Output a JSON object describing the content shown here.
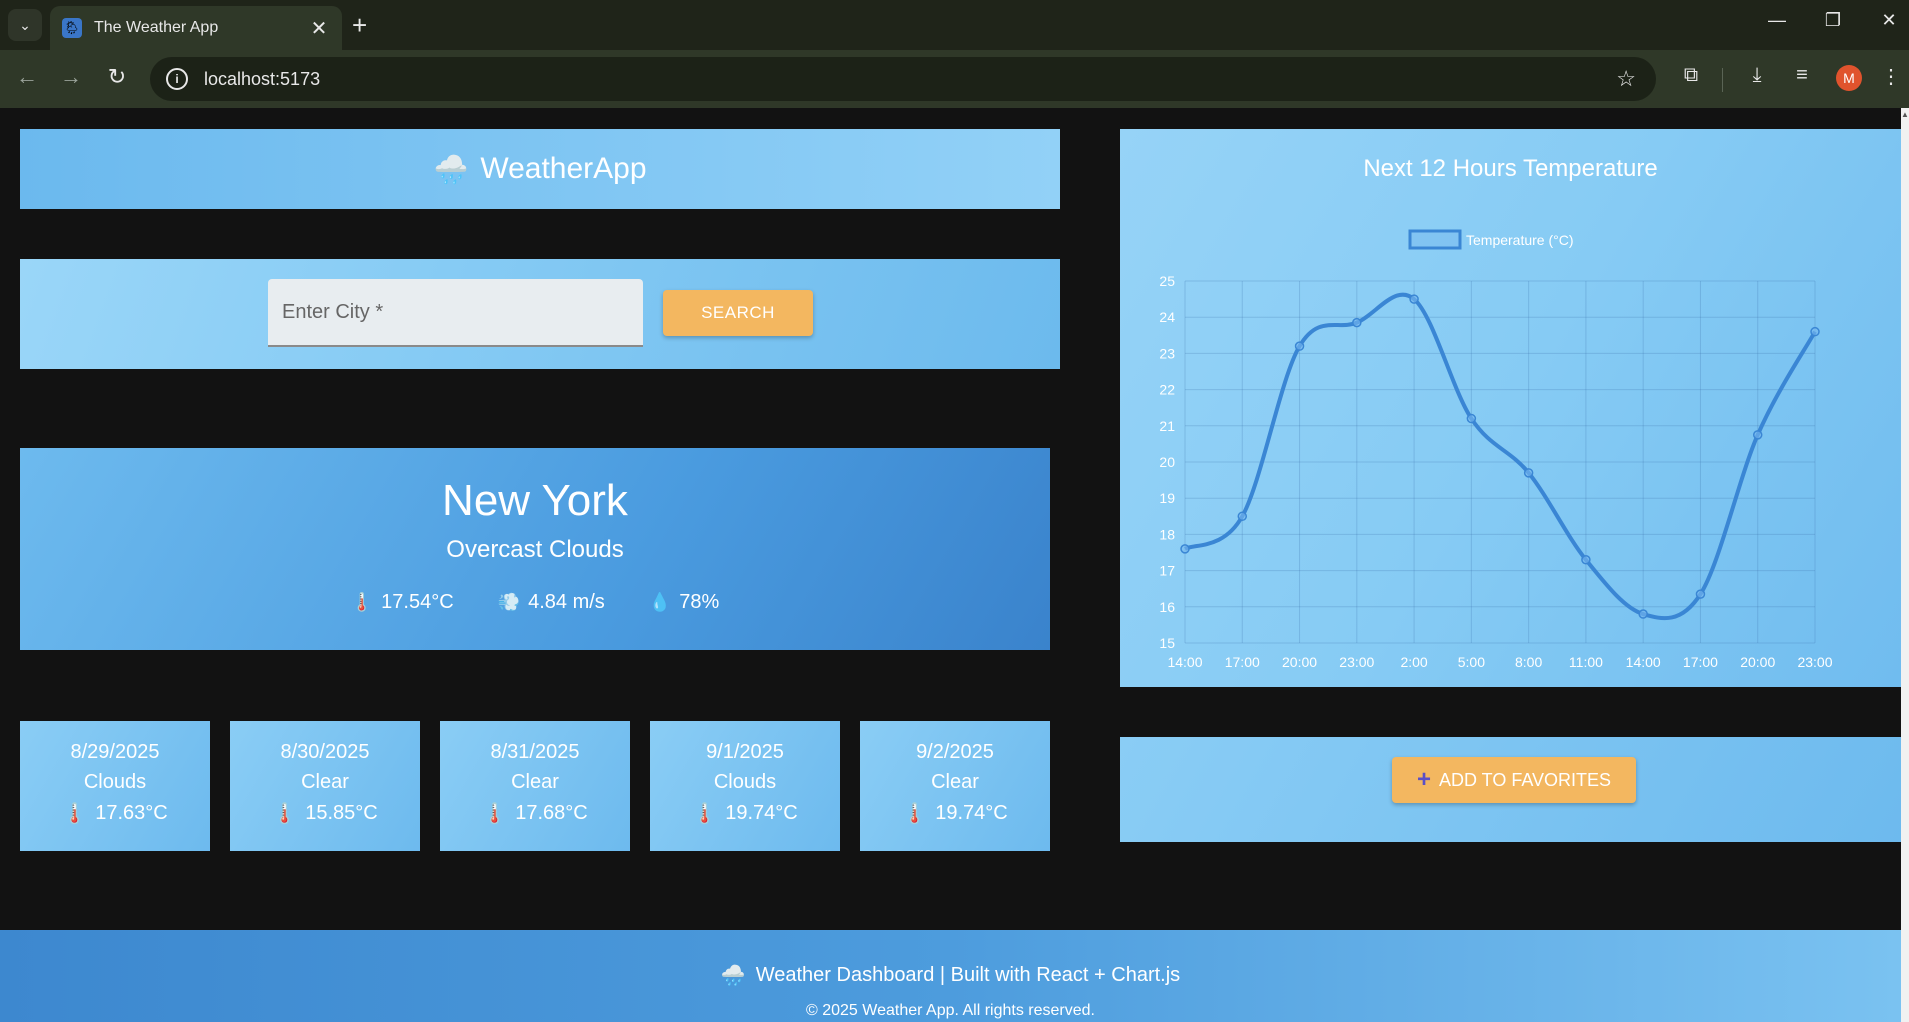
{
  "browser": {
    "tab_title": "The Weather App",
    "tab_close": "✕",
    "new_tab": "+",
    "url": "localhost:5173",
    "profile_initial": "M",
    "icons": [
      "tab-search-icon",
      "back-icon",
      "forward-icon",
      "reload-icon",
      "site-info-icon",
      "bookmark-star-icon",
      "extensions-icon",
      "downloads-icon",
      "media-icon",
      "menu-icon",
      "minimize-icon",
      "restore-icon",
      "close-icon"
    ]
  },
  "app": {
    "header_icon": "🌧️",
    "header_title": "WeatherApp",
    "search": {
      "placeholder": "Enter City *",
      "value": "",
      "button_label": "SEARCH"
    },
    "current": {
      "city": "New York",
      "condition": "Overcast Clouds",
      "temperature": "17.54°C",
      "wind": "4.84 m/s",
      "humidity": "78%",
      "temp_icon": "🌡️",
      "wind_icon": "💨",
      "humidity_icon": "💧"
    },
    "forecast": [
      {
        "date": "8/29/2025",
        "condition": "Clouds",
        "temp": "17.63°C"
      },
      {
        "date": "8/30/2025",
        "condition": "Clear",
        "temp": "15.85°C"
      },
      {
        "date": "8/31/2025",
        "condition": "Clear",
        "temp": "17.68°C"
      },
      {
        "date": "9/1/2025",
        "condition": "Clouds",
        "temp": "19.74°C"
      },
      {
        "date": "9/2/2025",
        "condition": "Clear",
        "temp": "19.74°C"
      }
    ],
    "forecast_icon": "🌡️",
    "favorites_button": "ADD TO FAVORITES",
    "footer": {
      "icon": "🌧️",
      "text": "Weather Dashboard | Built with React + Chart.js",
      "copyright": "© 2025 Weather App. All rights reserved."
    },
    "colors": {
      "accent_button": "#f3b760",
      "line": "#3a86d4",
      "card_light": "#8acdf5"
    }
  },
  "chart_data": {
    "type": "line",
    "title": "Next 12 Hours Temperature",
    "xlabel": "",
    "ylabel": "",
    "categories": [
      "14:00",
      "17:00",
      "20:00",
      "23:00",
      "2:00",
      "5:00",
      "8:00",
      "11:00",
      "14:00",
      "17:00",
      "20:00",
      "23:00"
    ],
    "series": [
      {
        "name": "Temperature (°C)",
        "values": [
          17.6,
          18.5,
          23.2,
          23.85,
          24.5,
          21.2,
          19.7,
          17.3,
          15.8,
          16.35,
          20.75,
          23.6
        ]
      }
    ],
    "yticks": [
      15,
      16,
      17,
      18,
      19,
      20,
      21,
      22,
      23,
      24,
      25
    ],
    "ylim": [
      15,
      25
    ],
    "grid": true,
    "legend": "top"
  }
}
